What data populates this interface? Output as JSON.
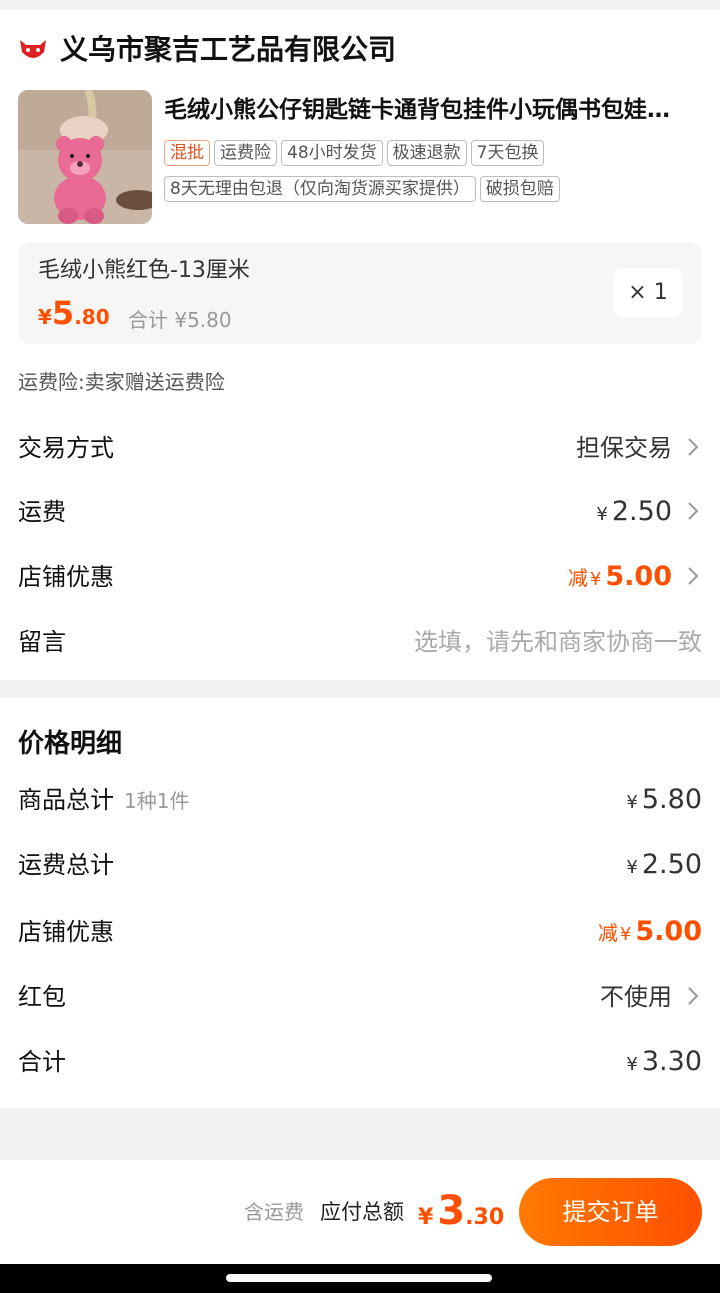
{
  "shop": {
    "name": "义乌市聚吉工艺品有限公司",
    "logo_icon": "tmall-cat-icon",
    "brand_color": "#e02020"
  },
  "product": {
    "title": "毛绒小熊公仔钥匙链卡通背包挂件小玩偶书包娃…",
    "tags": [
      "混批",
      "运费险",
      "48小时发货",
      "极速退款",
      "7天包换",
      "8天无理由包退（仅向淘货源买家提供）",
      "破损包赔"
    ],
    "sku": {
      "name": "毛绒小熊红色-13厘米",
      "price_currency": "¥",
      "price_int": "5",
      "price_dec": ".80",
      "subtotal": "合计 ¥5.80",
      "quantity": "× 1"
    },
    "insurance_note": "运费险:卖家赠送运费险"
  },
  "order_rows": {
    "trade_label": "交易方式",
    "trade_value": "担保交易",
    "shipping_label": "运费",
    "shipping_value": "2.50",
    "discount_label": "店铺优惠",
    "discount_prefix": "减",
    "discount_value": "5.00",
    "message_label": "留言",
    "message_placeholder": "选填，请先和商家协商一致"
  },
  "price_detail": {
    "title": "价格明细",
    "goods_label": "商品总计",
    "goods_count": "1种1件",
    "goods_value": "5.80",
    "shipping_label": "运费总计",
    "shipping_value": "2.50",
    "discount_label": "店铺优惠",
    "discount_prefix": "减",
    "discount_value": "5.00",
    "redpacket_label": "红包",
    "redpacket_value": "不使用",
    "total_label": "合计",
    "total_value": "3.30"
  },
  "currency": "¥",
  "bottom_bar": {
    "incl_shipping": "含运费",
    "due_label": "应付总额",
    "due_currency": "¥",
    "due_int": "3",
    "due_dec": ".30",
    "submit_label": "提交订单"
  },
  "colors": {
    "accent": "#ff4f00",
    "brand": "#e02020"
  }
}
